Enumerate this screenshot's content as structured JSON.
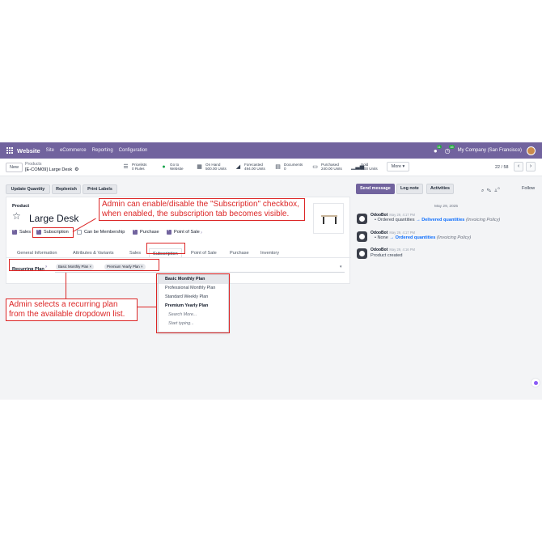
{
  "nav": {
    "app_name": "Website",
    "menu": [
      "Site",
      "eCommerce",
      "Reporting",
      "Configuration"
    ],
    "chat_badge": "11",
    "activity_badge": "16",
    "company": "My Company (San Francisco)"
  },
  "control": {
    "new_label": "New",
    "breadcrumb_parent": "Products",
    "breadcrumb_record": "[E-COM09] Large Desk",
    "smart_buttons": [
      {
        "icon": "pricelist-icon",
        "line1": "Pricelists",
        "line2": "0 Rules"
      },
      {
        "icon": "globe-icon",
        "line1": "Go to",
        "line2": "Website"
      },
      {
        "icon": "boxes-icon",
        "line1": "On Hand",
        "line2": "500.00 Units"
      },
      {
        "icon": "chart-area-icon",
        "line1": "Forecasted",
        "line2": "494.00 Units"
      },
      {
        "icon": "document-icon",
        "line1": "Documents",
        "line2": "0"
      },
      {
        "icon": "credit-card-icon",
        "line1": "Purchased",
        "line2": "240.00 Units"
      },
      {
        "icon": "bar-chart-icon",
        "line1": "Sold",
        "line2": "7.00 Units"
      }
    ],
    "more_label": "More ▾",
    "pager": "22 / 58"
  },
  "actions": [
    "Update Quantity",
    "Replenish",
    "Print Labels"
  ],
  "form": {
    "product_label": "Product",
    "product_name": "Large Desk",
    "checkboxes": [
      {
        "label": "Sales",
        "checked": true,
        "tooltip": false
      },
      {
        "label": "Subscription",
        "checked": true,
        "tooltip": false
      },
      {
        "label": "Can be Membership",
        "checked": false,
        "tooltip": false
      },
      {
        "label": "Purchase",
        "checked": true,
        "tooltip": false
      },
      {
        "label": "Point of Sale",
        "checked": true,
        "tooltip": true
      }
    ],
    "tooltip_mark": "?",
    "tabs": [
      "General Information",
      "Attributes & Variants",
      "Sales",
      "Subscription",
      "Point of Sale",
      "Purchase",
      "Inventory"
    ],
    "active_tab": "Subscription",
    "recurring_label": "Recurring Plan",
    "recurring_tags": [
      "Basic Monthly Plan ×",
      "Premium Yearly Plan ×"
    ]
  },
  "dropdown": [
    "Basic Monthly Plan",
    "Professional Monthly Plan",
    "Standard Weekly Plan",
    "Premium Yearly Plan",
    "Search More...",
    "Start typing..."
  ],
  "annotations": {
    "top": "Admin can enable/disable the \"Subscription\" checkbox, when enabled, the subscription tab becomes visible.",
    "bottom": "Admin selects a recurring plan from the available dropdown list."
  },
  "chatter": {
    "send_message": "Send message",
    "log_note": "Log note",
    "activities": "Activities",
    "follow": "Follow",
    "followers_count": "0",
    "date": "May 29, 2025",
    "messages": [
      {
        "author": "OdooBot",
        "time": "May 29, 4:17 PM",
        "old": "Ordered quantities",
        "arrow": "→",
        "new": "Delivered quantities",
        "field": "(Invoicing Policy)"
      },
      {
        "author": "OdooBot",
        "time": "May 29, 4:17 PM",
        "old": "None",
        "arrow": "→",
        "new": "Ordered quantities",
        "field": "(Invoicing Policy)"
      },
      {
        "author": "OdooBot",
        "time": "May 29, 4:16 PM",
        "body": "Product created"
      }
    ]
  },
  "colors": {
    "brand": "#71639e",
    "annotation": "#dc2626",
    "link": "#0d6efd"
  }
}
